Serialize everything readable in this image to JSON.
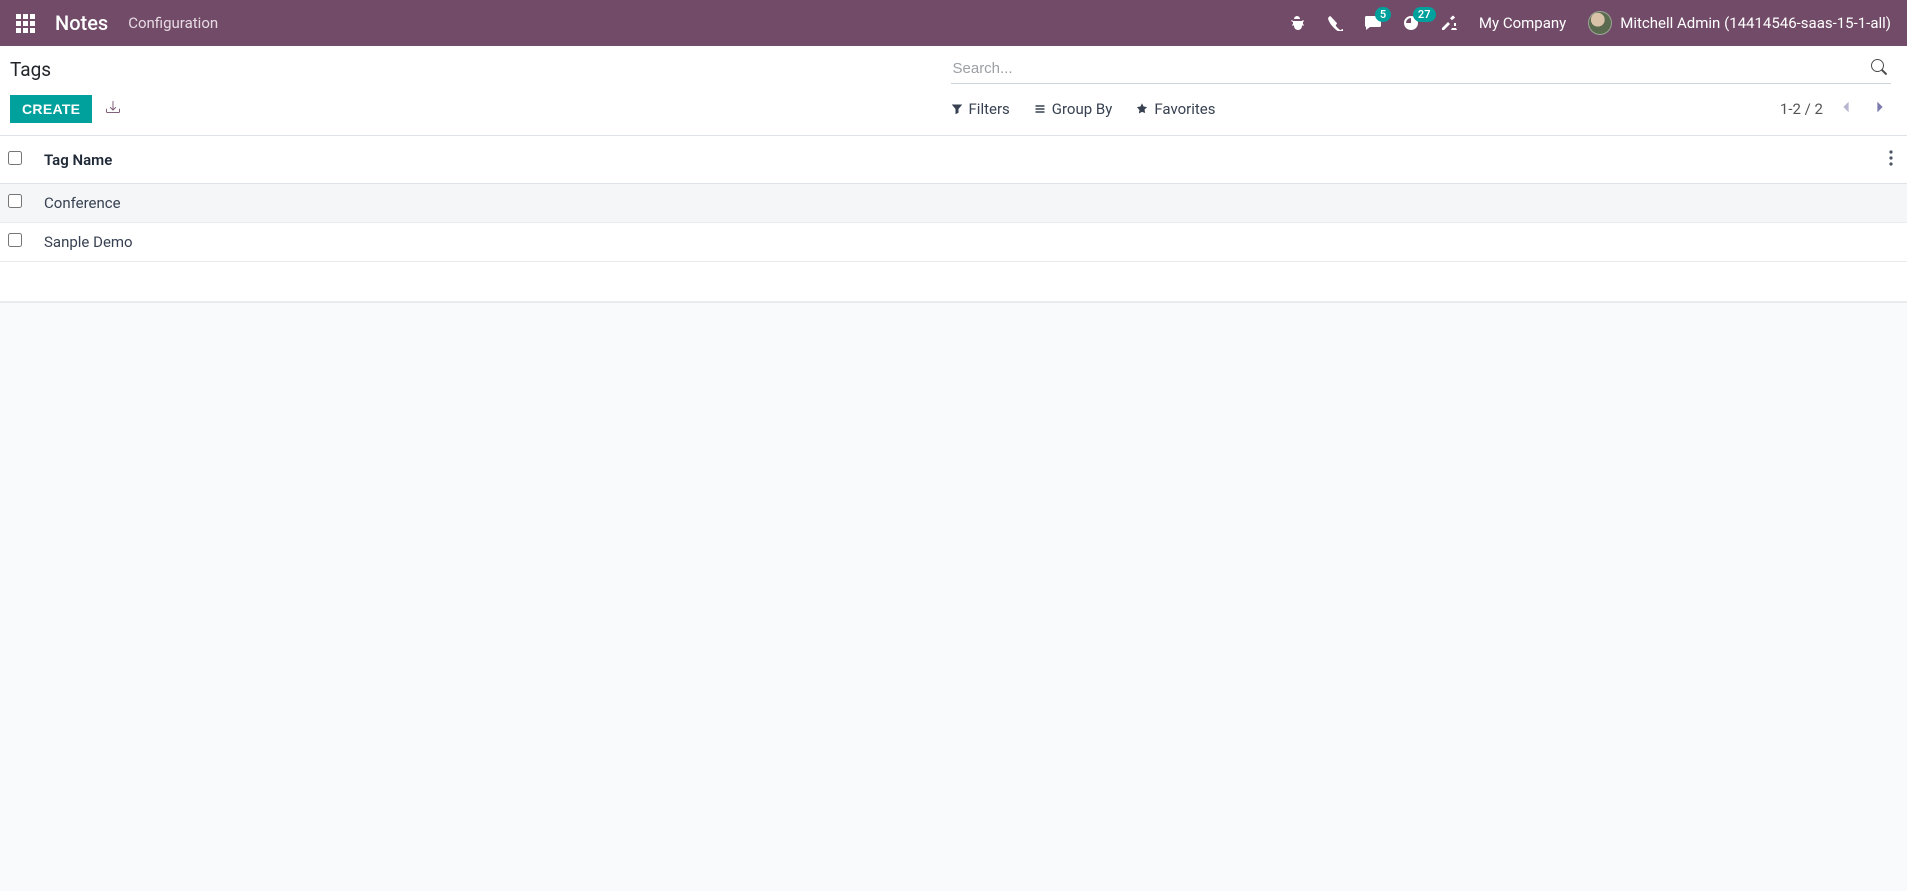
{
  "navbar": {
    "brand": "Notes",
    "menu": {
      "configuration": "Configuration"
    },
    "badges": {
      "messages": "5",
      "activities": "27"
    },
    "company": "My Company",
    "user": "Mitchell Admin (14414546-saas-15-1-all)"
  },
  "control_panel": {
    "title": "Tags",
    "create_label": "CREATE",
    "search_placeholder": "Search...",
    "filters_label": "Filters",
    "groupby_label": "Group By",
    "favorites_label": "Favorites",
    "pager": "1-2 / 2"
  },
  "table": {
    "header": {
      "tag_name": "Tag Name"
    },
    "rows": [
      {
        "name": "Conference"
      },
      {
        "name": "Sanple Demo"
      }
    ]
  }
}
